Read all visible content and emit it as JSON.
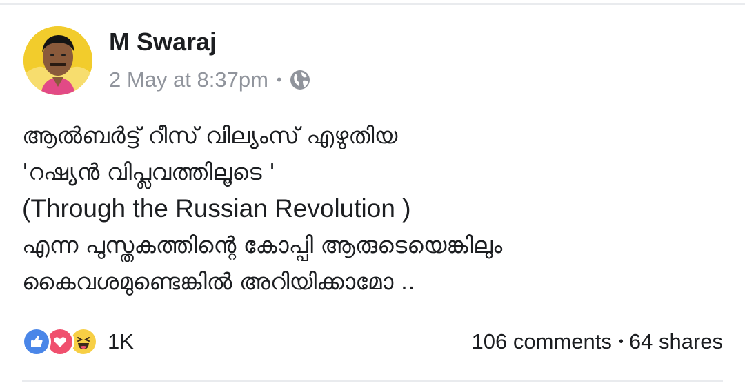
{
  "post": {
    "author": "M Swaraj",
    "timestamp": "2 May at 8:37pm",
    "separator": "•",
    "privacy_icon": "globe-icon",
    "text_lines": [
      "ആൽബർട്ട് റീസ് വില്യംസ് എഴുതിയ",
      "'റഷ്യൻ വിപ്ലവത്തിലൂടെ '",
      "(Through the Russian Revolution )",
      "എന്ന പുസ്തകത്തിന്റെ കോപ്പി ആരുടെയെങ്കിലും",
      "കൈവശമുണ്ടെങ്കിൽ അറിയിക്കാമോ .."
    ]
  },
  "footer": {
    "reactions": [
      "like-icon",
      "love-icon",
      "haha-icon"
    ],
    "reaction_count": "1K",
    "comments": "106 comments",
    "separator": "•",
    "shares": "64 shares"
  },
  "colors": {
    "text": "#1c1e21",
    "meta": "#90949c",
    "like": "#4a86e8",
    "love": "#f0506e",
    "haha": "#f7cf45",
    "divider": "#e9ebee"
  }
}
